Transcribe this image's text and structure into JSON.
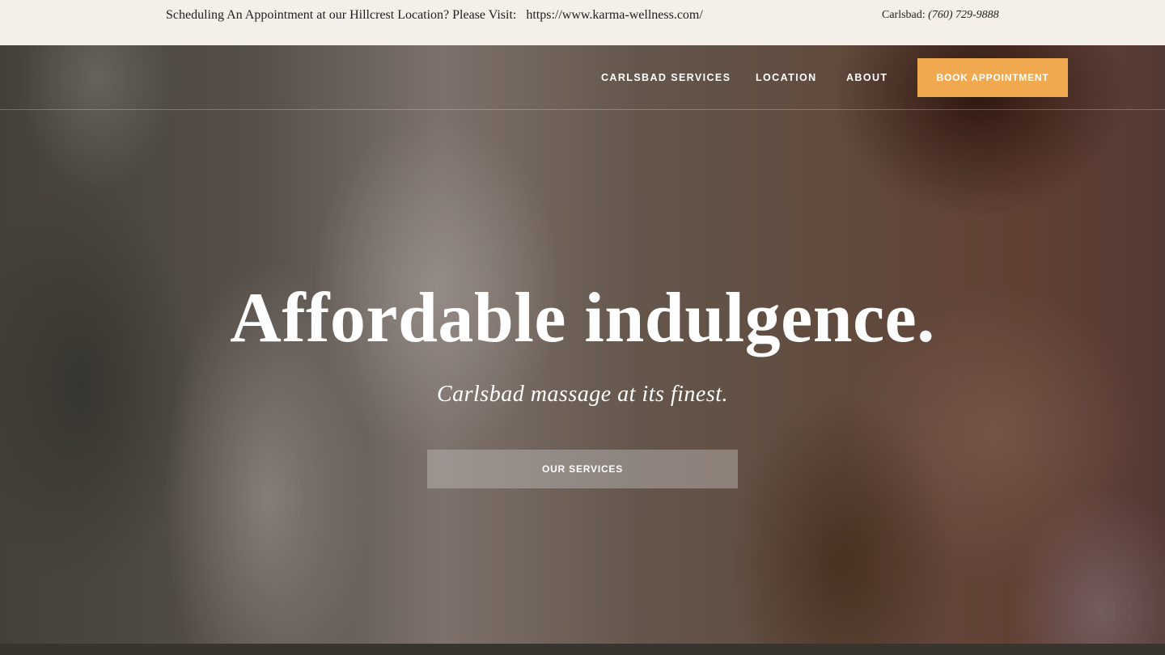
{
  "topbar": {
    "notice": "Scheduling An Appointment at our Hillcrest Location? Please Visit:",
    "url": "https://www.karma-wellness.com/",
    "phone_label": "Carlsbad:",
    "phone_number": "(760) 729-9888"
  },
  "nav": {
    "items": [
      {
        "label": "CARLSBAD SERVICES"
      },
      {
        "label": "LOCATION"
      },
      {
        "label": "ABOUT"
      }
    ],
    "book_label": "BOOK APPOINTMENT"
  },
  "hero": {
    "headline": "Affordable indulgence.",
    "subheadline": "Carlsbad massage at its finest.",
    "cta_label": "OUR SERVICES"
  },
  "colors": {
    "accent": "#f0a94f",
    "topbar_bg": "#f4efe9",
    "text_light": "#ffffff"
  }
}
